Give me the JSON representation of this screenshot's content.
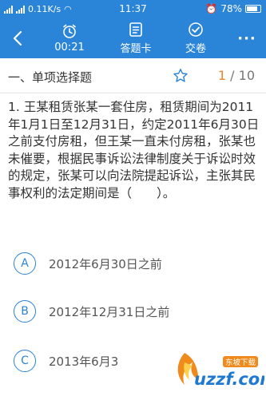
{
  "statusbar": {
    "network": "ılıl .ıll",
    "speed": "0.11K/s",
    "time": "11:37",
    "battery": "78%"
  },
  "toolbar": {
    "timer_label": "00:21",
    "card_label": "答题卡",
    "submit_label": "交卷",
    "more_label": "···"
  },
  "section": {
    "title": "一、单项选择题",
    "current": "1",
    "total": "/ 10"
  },
  "question": {
    "text": "1. 王某租赁张某一套住房，租赁期间为2011年1月1日至12月31日，约定2011年6月30日之前支付房租，但王某一直未付房租，张某也未催要，根据民事诉讼法律制度关于诉讼时效的规定，张某可以向法院提起诉讼，主张其民事权利的法定期间是（　　）。"
  },
  "options": [
    {
      "letter": "A",
      "text": "2012年6月30日之前"
    },
    {
      "letter": "B",
      "text": "2012年12月31日之前"
    },
    {
      "letter": "C",
      "text": "2013年6月3"
    }
  ],
  "watermark": {
    "brand_text": "uzzf.com",
    "badge_text": "东坡下载"
  },
  "colors": {
    "primary": "#2a84d8",
    "page_indicator": "#e8862a",
    "watermark_orange": "#f08a1c",
    "watermark_blue": "#1f78d1"
  }
}
